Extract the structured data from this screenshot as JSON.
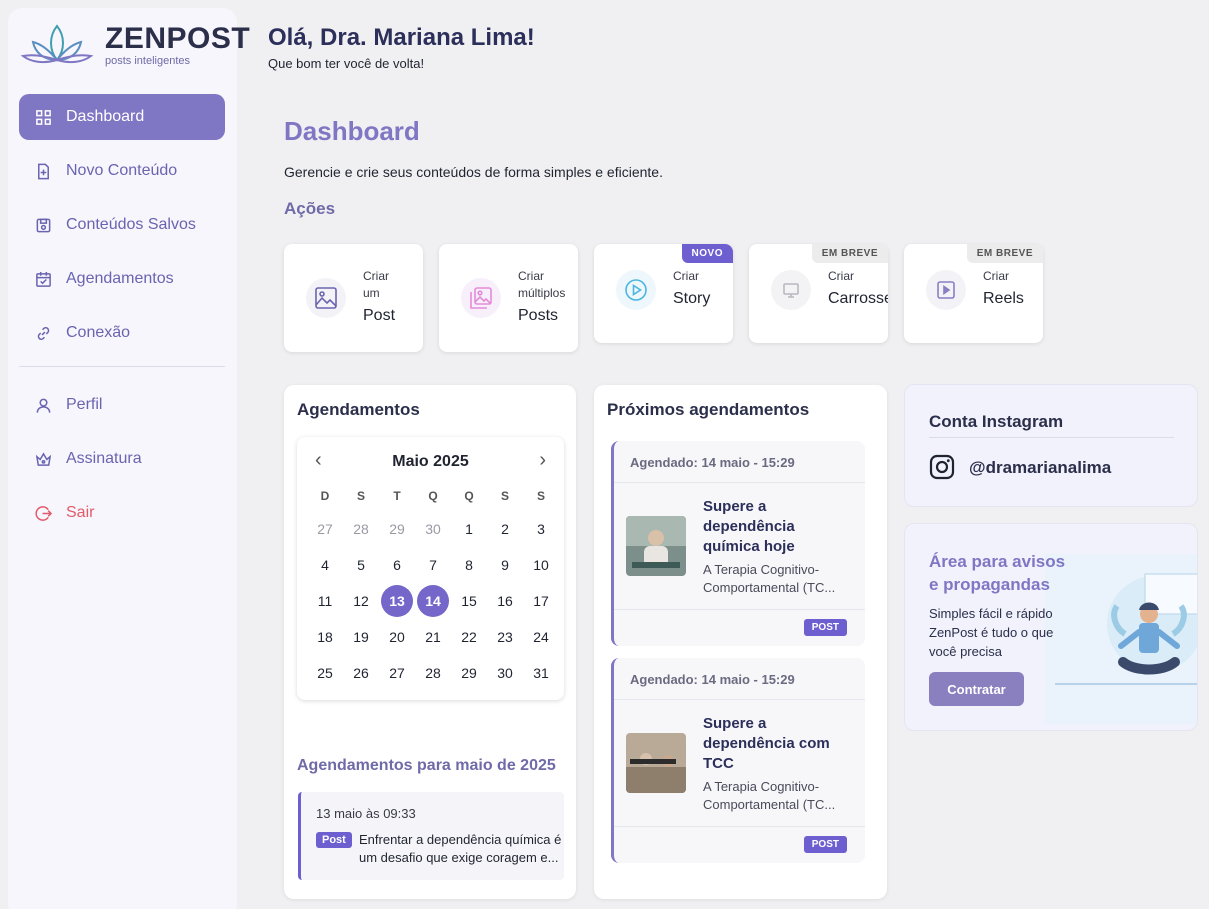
{
  "brand": {
    "name": "ZENPOST",
    "tagline": "posts inteligentes"
  },
  "sidebar": {
    "items": [
      {
        "label": "Dashboard",
        "icon": "grid-icon",
        "active": true
      },
      {
        "label": "Novo Conteúdo",
        "icon": "file-plus-icon"
      },
      {
        "label": "Conteúdos Salvos",
        "icon": "save-icon"
      },
      {
        "label": "Agendamentos",
        "icon": "calendar-icon"
      },
      {
        "label": "Conexão",
        "icon": "link-icon"
      },
      {
        "label": "Perfil",
        "icon": "user-icon"
      },
      {
        "label": "Assinatura",
        "icon": "crown-icon"
      },
      {
        "label": "Sair",
        "icon": "logout-icon"
      }
    ]
  },
  "header": {
    "greeting": "Olá, Dra. Mariana Lima!",
    "subtitle": "Que bom ter você de volta!"
  },
  "page": {
    "title": "Dashboard",
    "subtitle": "Gerencie e crie seus conteúdos de forma simples e eficiente.",
    "actions_title": "Ações"
  },
  "actions": [
    {
      "line1": "Criar",
      "line1b": "um",
      "line2": "Post",
      "icon": "image-icon"
    },
    {
      "line1": "Criar",
      "line1b": "múltiplos",
      "line2": "Posts",
      "icon": "images-icon"
    },
    {
      "line1": "Criar",
      "line2": "Story",
      "icon": "play-circle-icon",
      "badge": "NOVO"
    },
    {
      "line1": "Criar",
      "line2": "Carrossel",
      "icon": "monitor-icon",
      "badge": "EM BREVE"
    },
    {
      "line1": "Criar",
      "line2": "Reels",
      "icon": "play-square-icon",
      "badge": "EM BREVE"
    }
  ],
  "agendamentos": {
    "title": "Agendamentos",
    "month": "Maio 2025",
    "dow": [
      "D",
      "S",
      "T",
      "Q",
      "Q",
      "S",
      "S"
    ],
    "days": [
      [
        "27",
        "28",
        "29",
        "30",
        "1",
        "2",
        "3"
      ],
      [
        "4",
        "5",
        "6",
        "7",
        "8",
        "9",
        "10"
      ],
      [
        "11",
        "12",
        "13",
        "14",
        "15",
        "16",
        "17"
      ],
      [
        "18",
        "19",
        "20",
        "21",
        "22",
        "23",
        "24"
      ],
      [
        "25",
        "26",
        "27",
        "28",
        "29",
        "30",
        "31"
      ]
    ],
    "selected": [
      "13",
      "14"
    ],
    "month_list_title": "Agendamentos para maio de 2025",
    "month_item": {
      "date": "13 maio às 09:33",
      "tag": "Post",
      "text1": "Enfrentar a dependência química é",
      "text2": "um desafio que exige coragem e..."
    }
  },
  "proximos": {
    "title": "Próximos agendamentos",
    "items": [
      {
        "when": "Agendado: 14 maio - 15:29",
        "title": "Supere a dependência química hoje",
        "desc": "A Terapia Cognitivo-Comportamental (TC...",
        "tag": "POST"
      },
      {
        "when": "Agendado: 14 maio - 15:29",
        "title": "Supere a dependência com TCC",
        "desc": "A Terapia Cognitivo-Comportamental (TC...",
        "tag": "POST"
      }
    ]
  },
  "instagram": {
    "title": "Conta Instagram",
    "handle": "@dramarianalima"
  },
  "ad": {
    "title": "Área para avisos e propagandas",
    "text": "Simples fácil e rápido ZenPost é tudo o que você precisa",
    "button": "Contratar"
  },
  "colors": {
    "accent": "#7f76c4",
    "badge": "#6d5fd0",
    "logout": "#e35b6a"
  }
}
